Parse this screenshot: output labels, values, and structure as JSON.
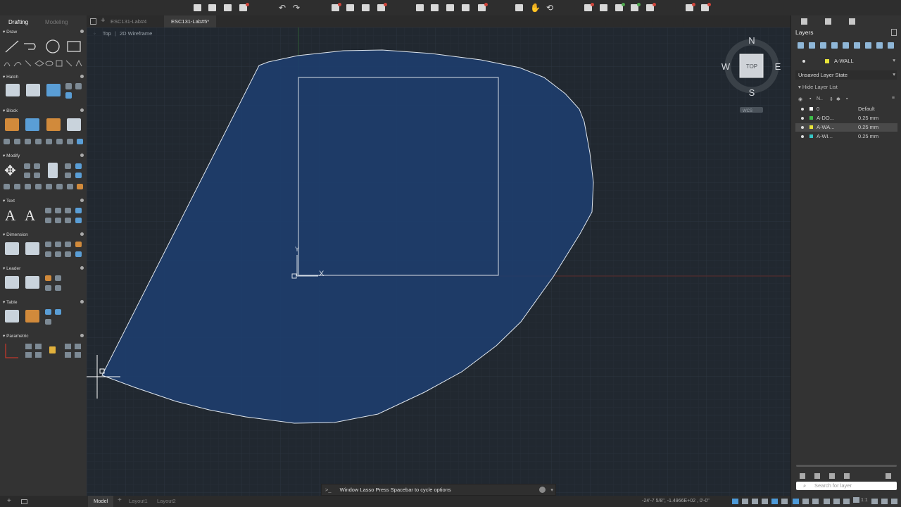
{
  "palette": {
    "tabs": [
      "Drafting",
      "Modeling"
    ],
    "sections": [
      "Draw",
      "Hatch",
      "Block",
      "Modify",
      "Text",
      "Dimension",
      "Leader",
      "Table",
      "Parametric"
    ]
  },
  "doc_tabs": [
    "ESC131-Lab#4",
    "ESC131-Lab#5*"
  ],
  "viewport": {
    "view_name": "Top",
    "visual_style": "2D Wireframe",
    "ucs_y_label": "Y",
    "ucs_x_label": "X",
    "background_color": "#212830",
    "selection_fill_color": "#1e3e6e"
  },
  "viewcube": {
    "north": "N",
    "south": "S",
    "east": "E",
    "west": "W",
    "face": "TOP",
    "wcs_label": "WCS"
  },
  "layers_panel": {
    "title": "Layers",
    "current_layer": "A-WALL",
    "current_layer_color": "#e8e43a",
    "layer_state": "Unsaved Layer State",
    "hide_list_label": "Hide Layer List",
    "column_name_header": "N..",
    "layers": [
      {
        "name": "0",
        "lineweight": "Default",
        "color": "#ffffff",
        "selected": false
      },
      {
        "name": "A-DO...",
        "lineweight": "0.25 mm",
        "color": "#3ec24a",
        "selected": false
      },
      {
        "name": "A-WA...",
        "lineweight": "0.25 mm",
        "color": "#e8e43a",
        "selected": true
      },
      {
        "name": "A-WI...",
        "lineweight": "0.25 mm",
        "color": "#37c6c6",
        "selected": false
      }
    ],
    "search_placeholder": "Search for layer"
  },
  "status": {
    "layout_tabs": [
      "Model",
      "Layout1",
      "Layout2"
    ],
    "command_text": "Window Lasso  Press Spacebar to cycle options",
    "command_prompt_icon": ">_",
    "coordinates": "-24'-7 5/8\", -1.4966E+02 , 0'-0\"",
    "scale": "1:1"
  }
}
